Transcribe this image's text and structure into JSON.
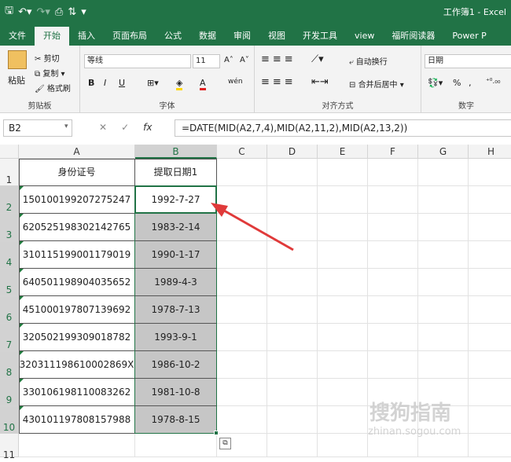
{
  "app": {
    "title": "工作簿1 - Excel"
  },
  "tabs": [
    "文件",
    "开始",
    "插入",
    "页面布局",
    "公式",
    "数据",
    "审阅",
    "视图",
    "开发工具",
    "view",
    "福昕阅读器",
    "Power P"
  ],
  "active_tab": "开始",
  "clipboard": {
    "paste": "粘贴",
    "cut": "剪切",
    "copy": "复制",
    "format_painter": "格式刷",
    "label": "剪贴板"
  },
  "font": {
    "name": "等线",
    "size": "11",
    "label": "字体",
    "grow": "A˄",
    "shrink": "A˅",
    "bold": "B",
    "italic": "I",
    "underline": "U",
    "phonetic": "wén"
  },
  "alignment": {
    "wrap": "自动换行",
    "merge": "合并后居中",
    "label": "对齐方式"
  },
  "number": {
    "format": "日期",
    "percent": "%",
    "comma": "‚",
    "label": "数字"
  },
  "formula_bar": {
    "name_box": "B2",
    "cancel": "✕",
    "enter": "✓",
    "fx": "fx",
    "formula": "=DATE(MID(A2,7,4),MID(A2,11,2),MID(A2,13,2))"
  },
  "columns": [
    "A",
    "B",
    "C",
    "D",
    "E",
    "F",
    "G",
    "H"
  ],
  "rows": [
    "1",
    "2",
    "3",
    "4",
    "5",
    "6",
    "7",
    "8",
    "9",
    "10",
    "11"
  ],
  "sheet": {
    "header": [
      "身份证号",
      "提取日期1"
    ],
    "data": [
      [
        "150100199207275247",
        "1992-7-27"
      ],
      [
        "620525198302142765",
        "1983-2-14"
      ],
      [
        "310115199001179019",
        "1990-1-17"
      ],
      [
        "640501198904035652",
        "1989-4-3"
      ],
      [
        "451000197807139692",
        "1978-7-13"
      ],
      [
        "320502199309018782",
        "1993-9-1"
      ],
      [
        "320311198610002869X",
        "1986-10-2"
      ],
      [
        "330106198110083262",
        "1981-10-8"
      ],
      [
        "430101197808157988",
        "1978-8-15"
      ]
    ]
  },
  "watermark": {
    "main": "搜狗指南",
    "sub": "zhinan.sogou.com"
  },
  "colors": {
    "accent": "#217346",
    "arrow": "#e03a3a",
    "selection": "#c6c6c6"
  }
}
